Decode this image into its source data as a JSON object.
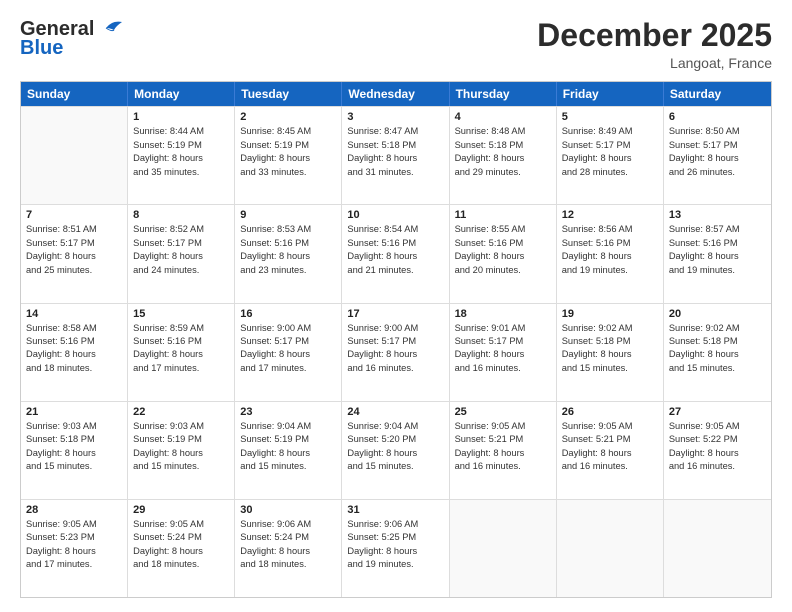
{
  "logo": {
    "line1": "General",
    "line2": "Blue"
  },
  "title": "December 2025",
  "location": "Langoat, France",
  "days": [
    "Sunday",
    "Monday",
    "Tuesday",
    "Wednesday",
    "Thursday",
    "Friday",
    "Saturday"
  ],
  "weeks": [
    [
      {
        "day": "",
        "sunrise": "",
        "sunset": "",
        "daylight": ""
      },
      {
        "day": "1",
        "sunrise": "Sunrise: 8:44 AM",
        "sunset": "Sunset: 5:19 PM",
        "daylight": "Daylight: 8 hours and 35 minutes."
      },
      {
        "day": "2",
        "sunrise": "Sunrise: 8:45 AM",
        "sunset": "Sunset: 5:19 PM",
        "daylight": "Daylight: 8 hours and 33 minutes."
      },
      {
        "day": "3",
        "sunrise": "Sunrise: 8:47 AM",
        "sunset": "Sunset: 5:18 PM",
        "daylight": "Daylight: 8 hours and 31 minutes."
      },
      {
        "day": "4",
        "sunrise": "Sunrise: 8:48 AM",
        "sunset": "Sunset: 5:18 PM",
        "daylight": "Daylight: 8 hours and 29 minutes."
      },
      {
        "day": "5",
        "sunrise": "Sunrise: 8:49 AM",
        "sunset": "Sunset: 5:17 PM",
        "daylight": "Daylight: 8 hours and 28 minutes."
      },
      {
        "day": "6",
        "sunrise": "Sunrise: 8:50 AM",
        "sunset": "Sunset: 5:17 PM",
        "daylight": "Daylight: 8 hours and 26 minutes."
      }
    ],
    [
      {
        "day": "7",
        "sunrise": "Sunrise: 8:51 AM",
        "sunset": "Sunset: 5:17 PM",
        "daylight": "Daylight: 8 hours and 25 minutes."
      },
      {
        "day": "8",
        "sunrise": "Sunrise: 8:52 AM",
        "sunset": "Sunset: 5:17 PM",
        "daylight": "Daylight: 8 hours and 24 minutes."
      },
      {
        "day": "9",
        "sunrise": "Sunrise: 8:53 AM",
        "sunset": "Sunset: 5:16 PM",
        "daylight": "Daylight: 8 hours and 23 minutes."
      },
      {
        "day": "10",
        "sunrise": "Sunrise: 8:54 AM",
        "sunset": "Sunset: 5:16 PM",
        "daylight": "Daylight: 8 hours and 21 minutes."
      },
      {
        "day": "11",
        "sunrise": "Sunrise: 8:55 AM",
        "sunset": "Sunset: 5:16 PM",
        "daylight": "Daylight: 8 hours and 20 minutes."
      },
      {
        "day": "12",
        "sunrise": "Sunrise: 8:56 AM",
        "sunset": "Sunset: 5:16 PM",
        "daylight": "Daylight: 8 hours and 19 minutes."
      },
      {
        "day": "13",
        "sunrise": "Sunrise: 8:57 AM",
        "sunset": "Sunset: 5:16 PM",
        "daylight": "Daylight: 8 hours and 19 minutes."
      }
    ],
    [
      {
        "day": "14",
        "sunrise": "Sunrise: 8:58 AM",
        "sunset": "Sunset: 5:16 PM",
        "daylight": "Daylight: 8 hours and 18 minutes."
      },
      {
        "day": "15",
        "sunrise": "Sunrise: 8:59 AM",
        "sunset": "Sunset: 5:16 PM",
        "daylight": "Daylight: 8 hours and 17 minutes."
      },
      {
        "day": "16",
        "sunrise": "Sunrise: 9:00 AM",
        "sunset": "Sunset: 5:17 PM",
        "daylight": "Daylight: 8 hours and 17 minutes."
      },
      {
        "day": "17",
        "sunrise": "Sunrise: 9:00 AM",
        "sunset": "Sunset: 5:17 PM",
        "daylight": "Daylight: 8 hours and 16 minutes."
      },
      {
        "day": "18",
        "sunrise": "Sunrise: 9:01 AM",
        "sunset": "Sunset: 5:17 PM",
        "daylight": "Daylight: 8 hours and 16 minutes."
      },
      {
        "day": "19",
        "sunrise": "Sunrise: 9:02 AM",
        "sunset": "Sunset: 5:18 PM",
        "daylight": "Daylight: 8 hours and 15 minutes."
      },
      {
        "day": "20",
        "sunrise": "Sunrise: 9:02 AM",
        "sunset": "Sunset: 5:18 PM",
        "daylight": "Daylight: 8 hours and 15 minutes."
      }
    ],
    [
      {
        "day": "21",
        "sunrise": "Sunrise: 9:03 AM",
        "sunset": "Sunset: 5:18 PM",
        "daylight": "Daylight: 8 hours and 15 minutes."
      },
      {
        "day": "22",
        "sunrise": "Sunrise: 9:03 AM",
        "sunset": "Sunset: 5:19 PM",
        "daylight": "Daylight: 8 hours and 15 minutes."
      },
      {
        "day": "23",
        "sunrise": "Sunrise: 9:04 AM",
        "sunset": "Sunset: 5:19 PM",
        "daylight": "Daylight: 8 hours and 15 minutes."
      },
      {
        "day": "24",
        "sunrise": "Sunrise: 9:04 AM",
        "sunset": "Sunset: 5:20 PM",
        "daylight": "Daylight: 8 hours and 15 minutes."
      },
      {
        "day": "25",
        "sunrise": "Sunrise: 9:05 AM",
        "sunset": "Sunset: 5:21 PM",
        "daylight": "Daylight: 8 hours and 16 minutes."
      },
      {
        "day": "26",
        "sunrise": "Sunrise: 9:05 AM",
        "sunset": "Sunset: 5:21 PM",
        "daylight": "Daylight: 8 hours and 16 minutes."
      },
      {
        "day": "27",
        "sunrise": "Sunrise: 9:05 AM",
        "sunset": "Sunset: 5:22 PM",
        "daylight": "Daylight: 8 hours and 16 minutes."
      }
    ],
    [
      {
        "day": "28",
        "sunrise": "Sunrise: 9:05 AM",
        "sunset": "Sunset: 5:23 PM",
        "daylight": "Daylight: 8 hours and 17 minutes."
      },
      {
        "day": "29",
        "sunrise": "Sunrise: 9:05 AM",
        "sunset": "Sunset: 5:24 PM",
        "daylight": "Daylight: 8 hours and 18 minutes."
      },
      {
        "day": "30",
        "sunrise": "Sunrise: 9:06 AM",
        "sunset": "Sunset: 5:24 PM",
        "daylight": "Daylight: 8 hours and 18 minutes."
      },
      {
        "day": "31",
        "sunrise": "Sunrise: 9:06 AM",
        "sunset": "Sunset: 5:25 PM",
        "daylight": "Daylight: 8 hours and 19 minutes."
      },
      {
        "day": "",
        "sunrise": "",
        "sunset": "",
        "daylight": ""
      },
      {
        "day": "",
        "sunrise": "",
        "sunset": "",
        "daylight": ""
      },
      {
        "day": "",
        "sunrise": "",
        "sunset": "",
        "daylight": ""
      }
    ]
  ]
}
